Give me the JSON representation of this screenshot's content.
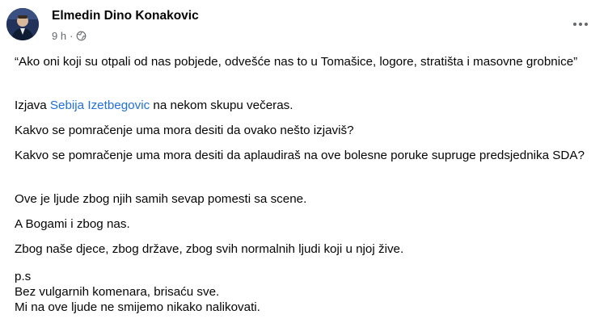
{
  "post": {
    "author": "Elmedin Dino Konakovic",
    "time": "9 h",
    "separator": "·",
    "privacy_icon": "globe-icon",
    "more_icon": "more-options-icon"
  },
  "content": {
    "quote": "“Ako oni koji su otpali od nas pobjede, odvešće nas to u Tomašice, logore, stratišta i masovne grobnice”",
    "izjava_prefix": "Izjava ",
    "izjava_link": "Sebija Izetbegovic",
    "izjava_suffix": " na nekom skupu večeras.",
    "line3": "Kakvo se pomračenje uma mora desiti da ovako nešto izjaviš?",
    "line4": "Kakvo se pomračenje uma mora desiti da aplaudiraš na ove bolesne poruke supruge predsjednika SDA?",
    "line5": "Ove je ljude zbog njih samih sevap pomesti sa scene.",
    "line6": "A Bogami i zbog nas.",
    "line7": "Zbog naše djece, zbog države, zbog svih normalnih ljudi koji u njoj žive.",
    "ps1": "p.s",
    "ps2": "Bez vulgarnih komenara, brisaću sve.",
    "ps3": "Mi na ove ljude ne smijemo nikako nalikovati."
  },
  "colors": {
    "text": "#050505",
    "secondary": "#65676b",
    "link": "#216fdb"
  }
}
